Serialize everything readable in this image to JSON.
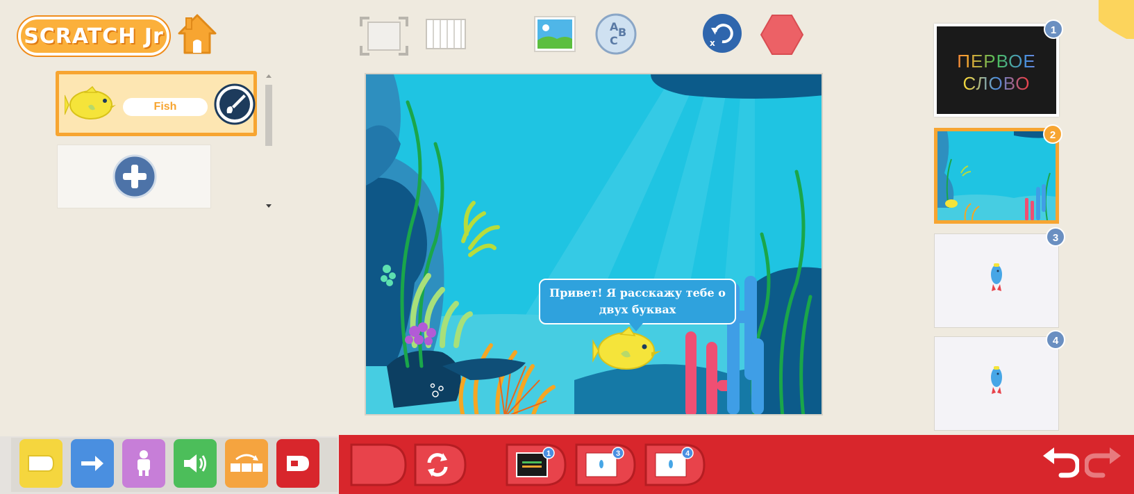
{
  "app": {
    "logo_text": "SCRATCH Jr",
    "brand_color": "#f7a531"
  },
  "toolbar": {
    "icons": [
      "home-icon",
      "fullscreen-icon",
      "grid-icon",
      "background-icon",
      "text-abc-icon",
      "reset-characters-icon",
      "stop-icon"
    ]
  },
  "sprites": {
    "items": [
      {
        "name": "Fish",
        "icon": "yellow-fish-icon",
        "selected": true
      }
    ],
    "add_icon": "plus-icon",
    "paint_icon": "paintbrush-icon"
  },
  "stage": {
    "speech_text": "Привет! Я расскажу тебе о двух буквах",
    "background": "underwater"
  },
  "pages": {
    "items": [
      {
        "number": "1",
        "title_line1": "ПЕРВОЕ",
        "title_line2": "СЛОВО"
      },
      {
        "number": "2",
        "selected": true
      },
      {
        "number": "3"
      },
      {
        "number": "4"
      }
    ]
  },
  "palette": {
    "categories": [
      {
        "name": "triggering",
        "color": "#f5d63e",
        "icon": "flag-block-icon"
      },
      {
        "name": "motion",
        "color": "#4a8fe0",
        "icon": "arrow-right-icon"
      },
      {
        "name": "looks",
        "color": "#c77ed8",
        "icon": "person-icon"
      },
      {
        "name": "sound",
        "color": "#4cbe5a",
        "icon": "speaker-icon"
      },
      {
        "name": "control",
        "color": "#f5a43f",
        "icon": "control-icon"
      },
      {
        "name": "end",
        "color": "#d8262c",
        "icon": "end-block-icon"
      }
    ],
    "end_blocks": [
      {
        "name": "end-block",
        "icon": "end-icon"
      },
      {
        "name": "repeat-forever-block",
        "icon": "repeat-forever-icon"
      },
      {
        "name": "go-to-page-1",
        "page": "1"
      },
      {
        "name": "go-to-page-3",
        "page": "3"
      },
      {
        "name": "go-to-page-4",
        "page": "4"
      }
    ],
    "undo_icon": "undo-icon",
    "redo_icon": "redo-icon"
  }
}
